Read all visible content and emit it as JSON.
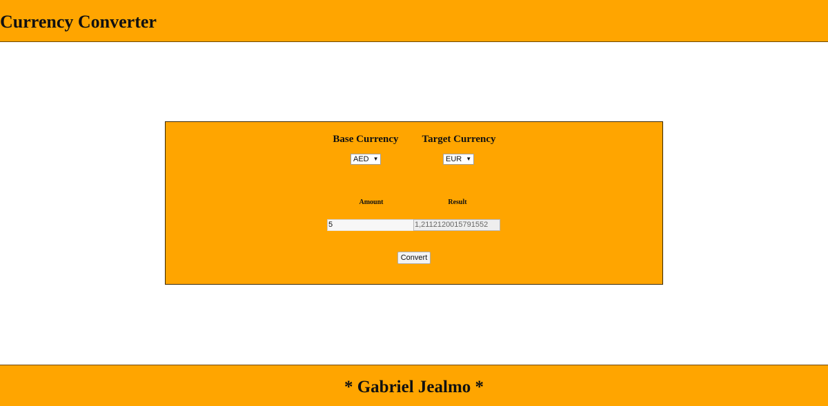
{
  "header": {
    "title": "Currency Converter"
  },
  "converter": {
    "base_currency_label": "Base Currency",
    "target_currency_label": "Target Currency",
    "base_currency_value": "AED",
    "target_currency_value": "EUR",
    "amount_label": "Amount",
    "result_label": "Result",
    "amount_value": "5",
    "result_value": "1,2112120015791552",
    "convert_label": "Convert"
  },
  "footer": {
    "text": "* Gabriel Jealmo *"
  },
  "colors": {
    "accent": "#ffa500",
    "background": "#ffffff",
    "text": "#111111"
  },
  "icons": {
    "dropdown": "chevron-down-icon"
  }
}
